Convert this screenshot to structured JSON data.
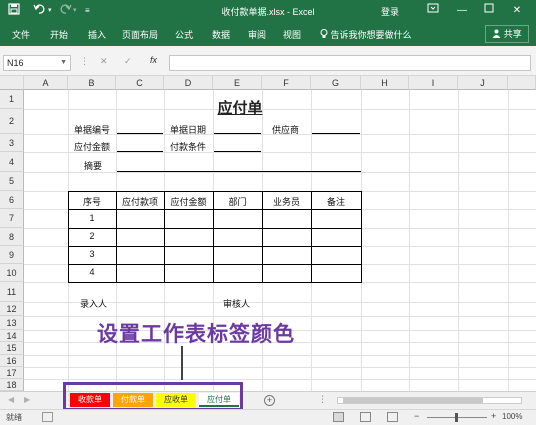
{
  "window": {
    "title": "收付款单据.xlsx  -  Excel",
    "login": "登录",
    "save_icon": "save-icon",
    "undo_icon": "undo-icon",
    "redo_icon": "redo-icon",
    "qa_more_icon": "customize-quick-access-icon",
    "ribbon_opts_icon": "ribbon-display-options-icon",
    "min_icon": "minimize-icon",
    "max_icon": "maximize-icon",
    "close_icon": "close-icon"
  },
  "ribbon": {
    "tabs": [
      "文件",
      "开始",
      "插入",
      "页面布局",
      "公式",
      "数据",
      "审阅",
      "视图"
    ],
    "tell_me": "告诉我你想要做什么",
    "share": "共享"
  },
  "formula_bar": {
    "name_box": "N16",
    "cancel_icon": "cancel-icon",
    "enter_icon": "enter-icon",
    "fx": "fx",
    "value": ""
  },
  "grid": {
    "columns": [
      "A",
      "B",
      "C",
      "D",
      "E",
      "F",
      "G",
      "H",
      "I",
      "J"
    ],
    "rows": [
      "1",
      "2",
      "3",
      "4",
      "5",
      "6",
      "7",
      "8",
      "9",
      "10",
      "11",
      "12",
      "13",
      "14",
      "15",
      "16",
      "17",
      "18"
    ]
  },
  "form": {
    "title": "应付单",
    "bill_no": "单据编号",
    "bill_date": "单据日期",
    "supplier": "供应商",
    "amount_due": "应付金额",
    "payment_terms": "付款条件",
    "summary": "摘要",
    "table_headers": [
      "序号",
      "应付款项",
      "应付金额",
      "部门",
      "业务员",
      "备注"
    ],
    "row_numbers": [
      "1",
      "2",
      "3",
      "4"
    ],
    "entered_by": "录入人",
    "reviewer": "审核人"
  },
  "annotation": "设置工作表标签颜色",
  "sheet_tabs": [
    {
      "label": "收款单",
      "color": "#ff0000",
      "text_color": "#ffffff"
    },
    {
      "label": "付款单",
      "color": "#ffa500",
      "text_color": "#ffffff"
    },
    {
      "label": "应收单",
      "color": "#ffff00",
      "text_color": "#333333"
    },
    {
      "label": "应付单",
      "color": "#ffffff",
      "text_color": "#217346"
    }
  ],
  "status": {
    "ready": "就绪",
    "zoom": "100%",
    "zoom_minus": "−",
    "zoom_plus": "+"
  },
  "colors": {
    "excel_green": "#217346",
    "annotation_purple": "#6b3aa0"
  }
}
